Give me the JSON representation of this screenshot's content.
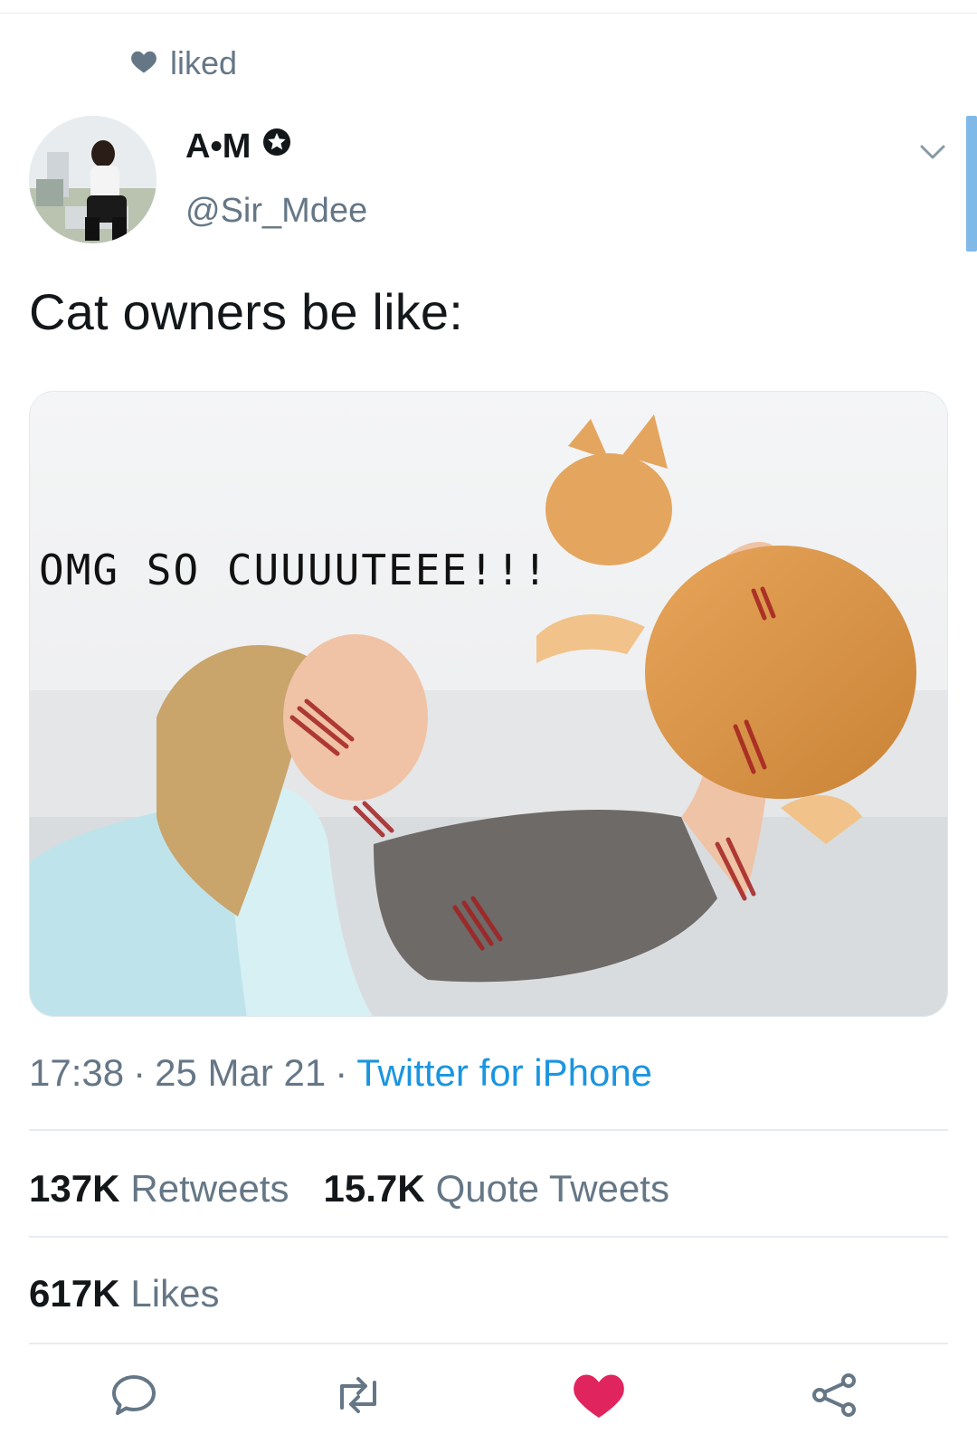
{
  "social_context": {
    "icon": "heart-icon",
    "text": "liked"
  },
  "author": {
    "name": "A•M",
    "handle": "@Sir_Mdee",
    "badge_icon": "star-badge-icon"
  },
  "tweet": {
    "text": "Cat owners be like:",
    "media": {
      "caption": "OMG SO CUUUUTEEE!!!",
      "alt": "Meme: smiling woman lifting an orange tabby cat, scratch marks on her face and arms"
    }
  },
  "meta": {
    "time": "17:38",
    "sep1": "·",
    "date": "25 Mar 21",
    "sep2": "·",
    "source": "Twitter for iPhone"
  },
  "stats": {
    "retweets": {
      "count": "137K",
      "label": "Retweets"
    },
    "quotes": {
      "count": "15.7K",
      "label": "Quote Tweets"
    },
    "likes": {
      "count": "617K",
      "label": "Likes"
    }
  },
  "actions": [
    {
      "name": "reply-icon"
    },
    {
      "name": "retweet-icon"
    },
    {
      "name": "like-icon",
      "active": true,
      "color": "#e0245e"
    },
    {
      "name": "share-icon"
    }
  ],
  "colors": {
    "link": "#1b95e0",
    "secondary": "#657786",
    "like": "#e0245e"
  }
}
